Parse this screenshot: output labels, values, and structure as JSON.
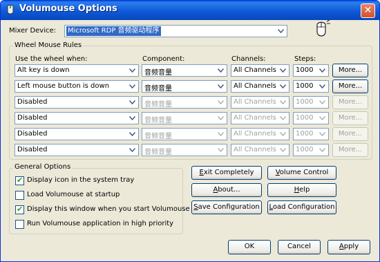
{
  "window": {
    "title": "Volumouse Options",
    "close_glyph": "✕"
  },
  "mixer": {
    "label": "Mixer Device:",
    "value": "Microsoft RDP 音频驱动程序"
  },
  "rules": {
    "group_title": "Wheel Mouse Rules",
    "headers": {
      "when": "Use the wheel when:",
      "component": "Component:",
      "channels": "Channels:",
      "steps": "Steps:"
    },
    "rows": [
      {
        "when": "Alt key is down",
        "component": "音频音量",
        "channels": "All Channels",
        "steps": "1000",
        "more": "More...",
        "enabled": true
      },
      {
        "when": "Left mouse button is down",
        "component": "音频音量",
        "channels": "All Channels",
        "steps": "1000",
        "more": "More...",
        "enabled": true
      },
      {
        "when": "Disabled",
        "component": "音频音量",
        "channels": "All Channels",
        "steps": "1000",
        "more": "More...",
        "enabled": false
      },
      {
        "when": "Disabled",
        "component": "音频音量",
        "channels": "All Channels",
        "steps": "1000",
        "more": "More...",
        "enabled": false
      },
      {
        "when": "Disabled",
        "component": "音频音量",
        "channels": "All Channels",
        "steps": "1000",
        "more": "More...",
        "enabled": false
      },
      {
        "when": "Disabled",
        "component": "音频音量",
        "channels": "All Channels",
        "steps": "1000",
        "more": "More...",
        "enabled": false
      }
    ]
  },
  "general": {
    "group_title": "General Options",
    "options": [
      {
        "label": "Display icon in the system tray",
        "checked": true
      },
      {
        "label": "Load Volumouse at startup",
        "checked": false
      },
      {
        "label": "Display this window when you start Volumouse",
        "checked": true
      },
      {
        "label": "Run Volumouse application in high priority",
        "checked": false
      }
    ]
  },
  "actions": {
    "exit_hk": "E",
    "exit_rest": "xit Completely",
    "volume_hk": "V",
    "volume_rest": "olume Control",
    "about_hk": "A",
    "about_rest": "bout...",
    "help_hk": "H",
    "help_rest": "elp",
    "save_hk": "S",
    "save_rest": "ave Configuration",
    "load_hk": "L",
    "load_rest": "oad Configuration"
  },
  "footer": {
    "ok": "OK",
    "cancel": "Cancel",
    "apply_hk": "A",
    "apply_rest": "pply"
  },
  "colors": {
    "titlebar": "#0a5fdb",
    "dialog_bg": "#ece9d8",
    "selection": "#316ac5",
    "check": "#21a121"
  },
  "icons": {
    "app": "volumouse-icon",
    "mouse": "mouse-icon",
    "dropdown": "chevron-down-icon"
  }
}
